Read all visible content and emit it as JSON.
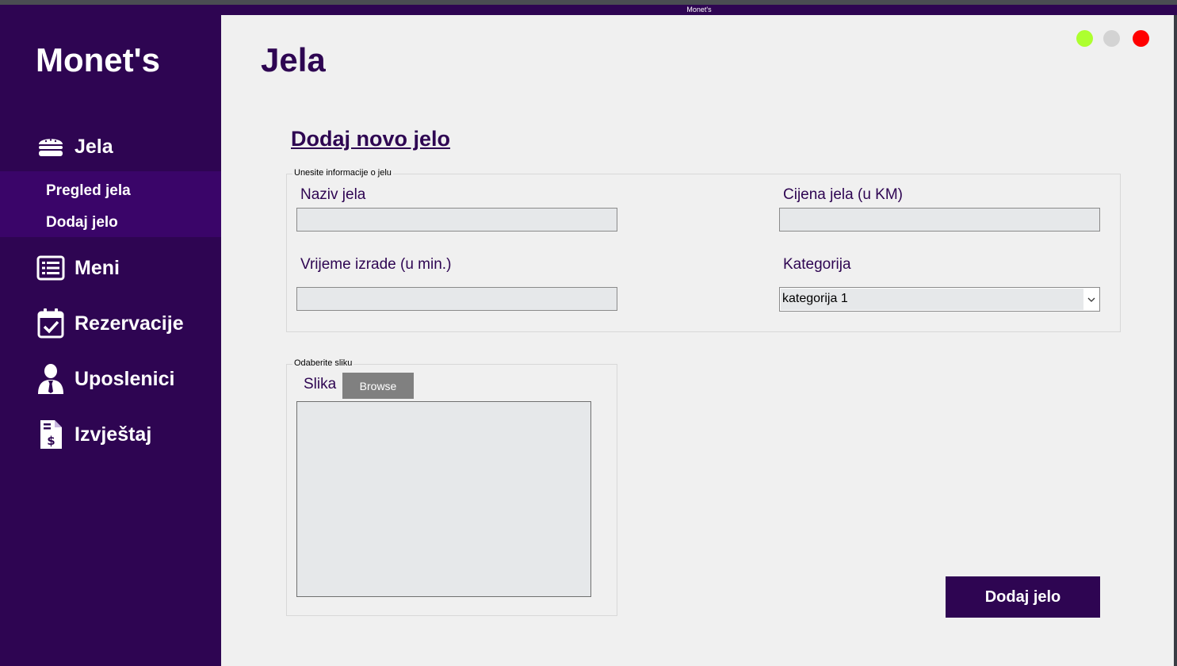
{
  "window": {
    "title": "Monet's"
  },
  "colors": {
    "brand": "#2e0552",
    "submenu_bg": "#3a0569",
    "content_bg": "#f0f0f0",
    "minimize": "#adff2f",
    "maximize": "#d3d3d3",
    "close": "#ff0000",
    "input_bg": "#e6e8ea",
    "browse_bg": "#808080"
  },
  "sidebar": {
    "brand": "Monet's",
    "items": [
      {
        "label": "Jela",
        "icon": "burger-icon"
      },
      {
        "label": "Meni",
        "icon": "list-icon"
      },
      {
        "label": "Rezervacije",
        "icon": "calendar-check-icon"
      },
      {
        "label": "Uposlenici",
        "icon": "employee-icon"
      },
      {
        "label": "Izvještaj",
        "icon": "invoice-dollar-icon"
      }
    ],
    "submenu": [
      {
        "label": "Pregled jela"
      },
      {
        "label": "Dodaj jelo"
      }
    ]
  },
  "header": {
    "title": "Jela"
  },
  "form": {
    "title": "Dodaj novo jelo",
    "info_group_legend": "Unesite informacije o jelu",
    "name_label": "Naziv jela",
    "name_value": "",
    "price_label": "Cijena jela (u KM)",
    "price_value": "",
    "time_label": "Vrijeme izrade (u min.)",
    "time_value": "",
    "category_label": "Kategorija",
    "category_value": "kategorija 1",
    "image_group_legend": "Odaberite sliku",
    "image_label": "Slika",
    "browse_label": "Browse",
    "submit_label": "Dodaj jelo"
  }
}
